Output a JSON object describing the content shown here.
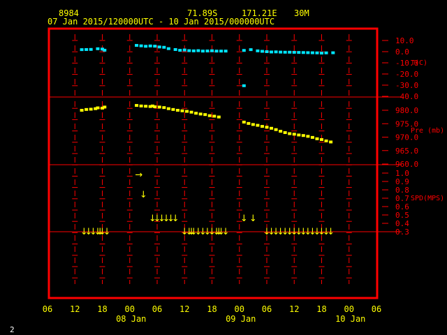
{
  "header": {
    "station": "8984",
    "lat": "71.89S",
    "lon": "171.21E",
    "interval": "30M",
    "period": "07 Jan 2015/120000UTC - 10 Jan 2015/000000UTC"
  },
  "page_number": "2",
  "colors": {
    "frame": "#ff0000",
    "grid": "#ff0000",
    "axis_text": "#ffff00",
    "right_labels": "#ff0000",
    "temperature": "#00e5ff",
    "pressure": "#ffff00",
    "wind": "#ffff00"
  },
  "chart_data": {
    "type": "scatter",
    "x_axis": {
      "unit": "hours since 07 Jan 2015 06 UTC",
      "range": [
        0,
        72
      ],
      "tick_labels": [
        "06",
        "12",
        "18",
        "00",
        "06",
        "12",
        "18",
        "00",
        "06",
        "12",
        "18",
        "00",
        "06"
      ],
      "date_labels": [
        {
          "text": "08 Jan",
          "x": 18
        },
        {
          "text": "09 Jan",
          "x": 42
        },
        {
          "text": "10 Jan",
          "x": 66
        }
      ]
    },
    "panels": [
      {
        "id": "temperature",
        "ylabel": "T(C)",
        "ylim": [
          -40,
          10
        ],
        "ytick_labels": [
          "10.0",
          "0.0",
          "-10.0",
          "-20.0",
          "-30.0",
          "-40.0"
        ],
        "ytick_values": [
          10,
          0,
          -10,
          -20,
          -30,
          -40
        ],
        "points": [
          [
            7.5,
            1.8
          ],
          [
            8.5,
            1.9
          ],
          [
            9.5,
            2.0
          ],
          [
            11.0,
            2.6
          ],
          [
            12.0,
            2.3
          ],
          [
            12.5,
            1.3
          ],
          [
            19.5,
            5.6
          ],
          [
            20.5,
            5.2
          ],
          [
            21.5,
            4.8
          ],
          [
            22.5,
            5.1
          ],
          [
            23.5,
            4.9
          ],
          [
            24.5,
            4.2
          ],
          [
            25.5,
            3.9
          ],
          [
            26.5,
            2.7
          ],
          [
            28.0,
            1.9
          ],
          [
            29.0,
            1.2
          ],
          [
            30.0,
            1.5
          ],
          [
            31.0,
            0.9
          ],
          [
            32.0,
            0.7
          ],
          [
            33.0,
            0.9
          ],
          [
            34.0,
            0.5
          ],
          [
            35.0,
            0.6
          ],
          [
            36.0,
            0.8
          ],
          [
            37.0,
            0.5
          ],
          [
            38.0,
            0.5
          ],
          [
            39.0,
            0.5
          ],
          [
            43.0,
            1.1
          ],
          [
            44.5,
            1.8
          ],
          [
            46.0,
            0.7
          ],
          [
            47.0,
            0.3
          ],
          [
            48.0,
            0.0
          ],
          [
            49.0,
            -0.3
          ],
          [
            50.0,
            -0.2
          ],
          [
            51.0,
            -0.4
          ],
          [
            52.0,
            -0.5
          ],
          [
            53.0,
            -0.5
          ],
          [
            54.0,
            -0.6
          ],
          [
            55.0,
            -0.7
          ],
          [
            56.0,
            -0.8
          ],
          [
            57.0,
            -0.9
          ],
          [
            58.0,
            -1.0
          ],
          [
            59.0,
            -1.1
          ],
          [
            60.0,
            -1.3
          ],
          [
            61.0,
            -1.1
          ],
          [
            62.5,
            -1.0
          ],
          [
            43.0,
            -30.5
          ]
        ]
      },
      {
        "id": "pressure",
        "ylabel": "Pre (mb)",
        "ylim": [
          960,
          985
        ],
        "ytick_labels": [
          "980.0",
          "975.0",
          "970.0",
          "965.0",
          "960.0"
        ],
        "ytick_values": [
          980,
          975,
          970,
          965,
          960
        ],
        "points": [
          [
            7.5,
            980.0
          ],
          [
            8.5,
            980.3
          ],
          [
            9.5,
            980.4
          ],
          [
            10.5,
            980.6
          ],
          [
            11.0,
            980.9
          ],
          [
            12.0,
            980.8
          ],
          [
            12.5,
            981.2
          ],
          [
            19.5,
            981.8
          ],
          [
            20.5,
            981.6
          ],
          [
            21.5,
            981.5
          ],
          [
            22.5,
            981.4
          ],
          [
            23.0,
            981.6
          ],
          [
            23.5,
            981.3
          ],
          [
            24.5,
            981.2
          ],
          [
            25.5,
            981.0
          ],
          [
            26.5,
            980.6
          ],
          [
            27.5,
            980.3
          ],
          [
            28.5,
            980.0
          ],
          [
            29.5,
            979.8
          ],
          [
            30.5,
            979.6
          ],
          [
            31.5,
            979.3
          ],
          [
            32.5,
            978.9
          ],
          [
            33.5,
            978.6
          ],
          [
            34.5,
            978.4
          ],
          [
            35.5,
            978.0
          ],
          [
            36.5,
            977.8
          ],
          [
            37.5,
            977.5
          ],
          [
            43.0,
            975.6
          ],
          [
            44.0,
            975.1
          ],
          [
            45.0,
            974.7
          ],
          [
            46.0,
            974.4
          ],
          [
            47.0,
            974.0
          ],
          [
            48.0,
            973.7
          ],
          [
            49.0,
            973.3
          ],
          [
            50.0,
            972.8
          ],
          [
            51.0,
            972.2
          ],
          [
            52.0,
            971.7
          ],
          [
            53.0,
            971.3
          ],
          [
            54.0,
            971.1
          ],
          [
            55.0,
            970.8
          ],
          [
            56.0,
            970.6
          ],
          [
            57.0,
            970.3
          ],
          [
            58.0,
            969.9
          ],
          [
            59.0,
            969.4
          ],
          [
            60.0,
            969.1
          ],
          [
            61.0,
            968.6
          ],
          [
            62.0,
            968.2
          ]
        ]
      },
      {
        "id": "wind_speed",
        "ylabel": "SPD(MPS)",
        "ylim": [
          0.3,
          1.0
        ],
        "ytick_labels": [
          "1.0",
          "0.9",
          "0.8",
          "0.7",
          "0.6",
          "0.5",
          "0.4",
          "0.3"
        ],
        "ytick_values": [
          1.0,
          0.9,
          0.8,
          0.7,
          0.6,
          0.5,
          0.4,
          0.3
        ],
        "points": [
          [
            8,
            0.3
          ],
          [
            9,
            0.3
          ],
          [
            10,
            0.3
          ],
          [
            11,
            0.3
          ],
          [
            11.5,
            0.3
          ],
          [
            12,
            0.3
          ],
          [
            13,
            0.3
          ],
          [
            20,
            0.98
          ],
          [
            21,
            0.74
          ],
          [
            23,
            0.46
          ],
          [
            24,
            0.46
          ],
          [
            25,
            0.46
          ],
          [
            26,
            0.46
          ],
          [
            27,
            0.46
          ],
          [
            28,
            0.46
          ],
          [
            30,
            0.3
          ],
          [
            31,
            0.3
          ],
          [
            31.5,
            0.3
          ],
          [
            32,
            0.3
          ],
          [
            33,
            0.3
          ],
          [
            34,
            0.3
          ],
          [
            35,
            0.3
          ],
          [
            36,
            0.3
          ],
          [
            37,
            0.3
          ],
          [
            37.5,
            0.3
          ],
          [
            38,
            0.3
          ],
          [
            39,
            0.3
          ],
          [
            43,
            0.46
          ],
          [
            45,
            0.46
          ],
          [
            48,
            0.3
          ],
          [
            49,
            0.3
          ],
          [
            50,
            0.3
          ],
          [
            51,
            0.3
          ],
          [
            52,
            0.3
          ],
          [
            53,
            0.3
          ],
          [
            54,
            0.3
          ],
          [
            55,
            0.3
          ],
          [
            56,
            0.3
          ],
          [
            57,
            0.3
          ],
          [
            58,
            0.3
          ],
          [
            59,
            0.3
          ],
          [
            60,
            0.3
          ],
          [
            61,
            0.3
          ],
          [
            62,
            0.3
          ]
        ],
        "glyph": "↓",
        "special_glyph": {
          "x": 20,
          "glyph": "→"
        }
      }
    ]
  }
}
